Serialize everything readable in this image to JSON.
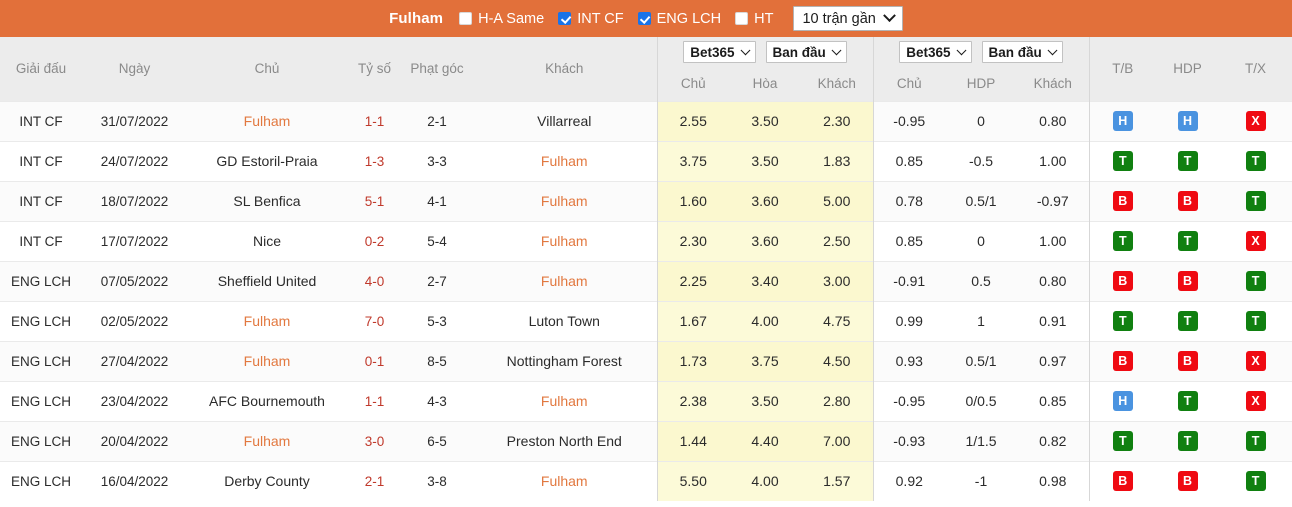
{
  "topbar": {
    "team": "Fulham",
    "filters": [
      {
        "label": "H-A Same",
        "checked": false
      },
      {
        "label": "INT CF",
        "checked": true
      },
      {
        "label": "ENG LCH",
        "checked": true
      },
      {
        "label": "HT",
        "checked": false
      }
    ],
    "range_select": "10 trận gần"
  },
  "table": {
    "headers": {
      "league": "Giải đấu",
      "date": "Ngày",
      "home": "Chủ",
      "score": "Tỷ số",
      "corner": "Phạt góc",
      "away": "Khách",
      "odds1_book": "Bet365",
      "odds1_type": "Ban đầu",
      "odds1_sub": [
        "Chủ",
        "Hòa",
        "Khách"
      ],
      "odds2_book": "Bet365",
      "odds2_type": "Ban đầu",
      "odds2_sub": [
        "Chủ",
        "HDP",
        "Khách"
      ],
      "tb": "T/B",
      "hdp": "HDP",
      "tx": "T/X"
    },
    "rows": [
      {
        "league": "INT CF",
        "date": "31/07/2022",
        "home": "Fulham",
        "home_hl": true,
        "score": "1-1",
        "corner": "2-1",
        "away": "Villarreal",
        "away_hl": false,
        "o1": [
          "2.55",
          "3.50",
          "2.30"
        ],
        "o2": [
          "-0.95",
          "0",
          "0.80"
        ],
        "tb": "H",
        "hdp": "H",
        "tx": "X"
      },
      {
        "league": "INT CF",
        "date": "24/07/2022",
        "home": "GD Estoril-Praia",
        "home_hl": false,
        "score": "1-3",
        "corner": "3-3",
        "away": "Fulham",
        "away_hl": true,
        "o1": [
          "3.75",
          "3.50",
          "1.83"
        ],
        "o2": [
          "0.85",
          "-0.5",
          "1.00"
        ],
        "tb": "T",
        "hdp": "T",
        "tx": "T"
      },
      {
        "league": "INT CF",
        "date": "18/07/2022",
        "home": "SL Benfica",
        "home_hl": false,
        "score": "5-1",
        "corner": "4-1",
        "away": "Fulham",
        "away_hl": true,
        "o1": [
          "1.60",
          "3.60",
          "5.00"
        ],
        "o2": [
          "0.78",
          "0.5/1",
          "-0.97"
        ],
        "tb": "B",
        "hdp": "B",
        "tx": "T"
      },
      {
        "league": "INT CF",
        "date": "17/07/2022",
        "home": "Nice",
        "home_hl": false,
        "score": "0-2",
        "corner": "5-4",
        "away": "Fulham",
        "away_hl": true,
        "o1": [
          "2.30",
          "3.60",
          "2.50"
        ],
        "o2": [
          "0.85",
          "0",
          "1.00"
        ],
        "tb": "T",
        "hdp": "T",
        "tx": "X"
      },
      {
        "league": "ENG LCH",
        "date": "07/05/2022",
        "home": "Sheffield United",
        "home_hl": false,
        "score": "4-0",
        "corner": "2-7",
        "away": "Fulham",
        "away_hl": true,
        "o1": [
          "2.25",
          "3.40",
          "3.00"
        ],
        "o2": [
          "-0.91",
          "0.5",
          "0.80"
        ],
        "tb": "B",
        "hdp": "B",
        "tx": "T"
      },
      {
        "league": "ENG LCH",
        "date": "02/05/2022",
        "home": "Fulham",
        "home_hl": true,
        "score": "7-0",
        "corner": "5-3",
        "away": "Luton Town",
        "away_hl": false,
        "o1": [
          "1.67",
          "4.00",
          "4.75"
        ],
        "o2": [
          "0.99",
          "1",
          "0.91"
        ],
        "tb": "T",
        "hdp": "T",
        "tx": "T"
      },
      {
        "league": "ENG LCH",
        "date": "27/04/2022",
        "home": "Fulham",
        "home_hl": true,
        "score": "0-1",
        "corner": "8-5",
        "away": "Nottingham Forest",
        "away_hl": false,
        "o1": [
          "1.73",
          "3.75",
          "4.50"
        ],
        "o2": [
          "0.93",
          "0.5/1",
          "0.97"
        ],
        "tb": "B",
        "hdp": "B",
        "tx": "X"
      },
      {
        "league": "ENG LCH",
        "date": "23/04/2022",
        "home": "AFC Bournemouth",
        "home_hl": false,
        "score": "1-1",
        "corner": "4-3",
        "away": "Fulham",
        "away_hl": true,
        "o1": [
          "2.38",
          "3.50",
          "2.80"
        ],
        "o2": [
          "-0.95",
          "0/0.5",
          "0.85"
        ],
        "tb": "H",
        "hdp": "T",
        "tx": "X"
      },
      {
        "league": "ENG LCH",
        "date": "20/04/2022",
        "home": "Fulham",
        "home_hl": true,
        "score": "3-0",
        "corner": "6-5",
        "away": "Preston North End",
        "away_hl": false,
        "o1": [
          "1.44",
          "4.40",
          "7.00"
        ],
        "o2": [
          "-0.93",
          "1/1.5",
          "0.82"
        ],
        "tb": "T",
        "hdp": "T",
        "tx": "T"
      },
      {
        "league": "ENG LCH",
        "date": "16/04/2022",
        "home": "Derby County",
        "home_hl": false,
        "score": "2-1",
        "corner": "3-8",
        "away": "Fulham",
        "away_hl": true,
        "o1": [
          "5.50",
          "4.00",
          "1.57"
        ],
        "o2": [
          "0.92",
          "-1",
          "0.98"
        ],
        "tb": "B",
        "hdp": "B",
        "tx": "T"
      }
    ]
  },
  "colors": {
    "topbar_bg": "#e2703a",
    "accent_team": "#e2783f",
    "score": "#c0392b",
    "highlight_row": "#fbf8cf",
    "badge_win": "#108010",
    "badge_lose": "#ef0a12",
    "badge_draw": "#4a93e0"
  }
}
